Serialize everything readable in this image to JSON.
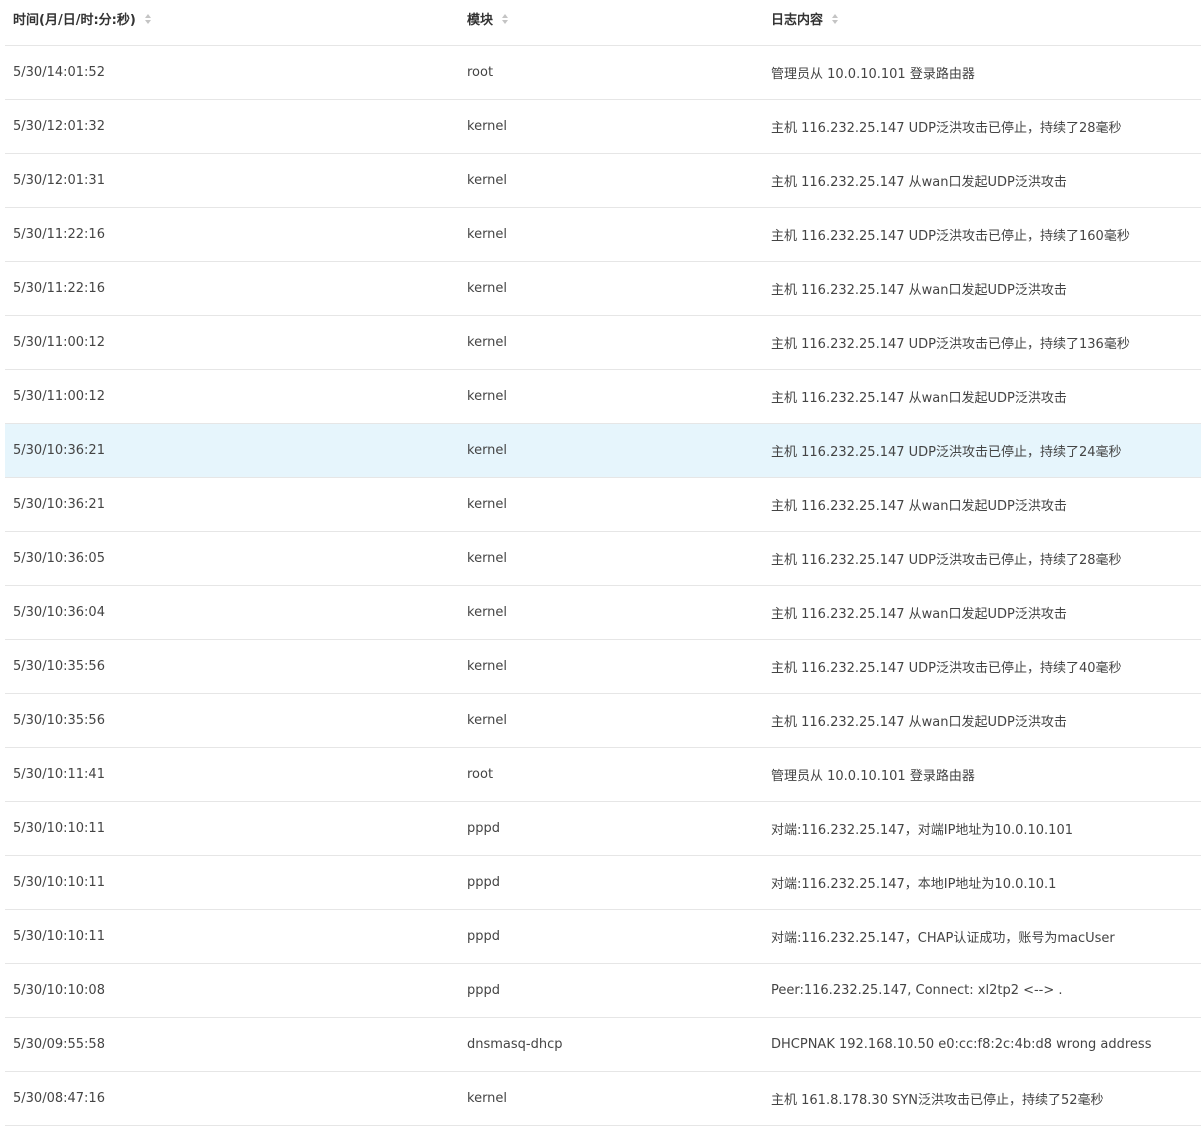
{
  "table": {
    "columns": [
      {
        "label": "时间(月/日/时:分:秒)"
      },
      {
        "label": "模块"
      },
      {
        "label": "日志内容"
      }
    ],
    "highlight_color": "#e6f5fc",
    "rows": [
      {
        "time": "5/30/14:01:52",
        "module": "root",
        "content": "管理员从 10.0.10.101 登录路由器"
      },
      {
        "time": "5/30/12:01:32",
        "module": "kernel",
        "content": "主机 116.232.25.147 UDP泛洪攻击已停止，持续了28毫秒"
      },
      {
        "time": "5/30/12:01:31",
        "module": "kernel",
        "content": "主机 116.232.25.147 从wan口发起UDP泛洪攻击"
      },
      {
        "time": "5/30/11:22:16",
        "module": "kernel",
        "content": "主机 116.232.25.147 UDP泛洪攻击已停止，持续了160毫秒"
      },
      {
        "time": "5/30/11:22:16",
        "module": "kernel",
        "content": "主机 116.232.25.147 从wan口发起UDP泛洪攻击"
      },
      {
        "time": "5/30/11:00:12",
        "module": "kernel",
        "content": "主机 116.232.25.147 UDP泛洪攻击已停止，持续了136毫秒"
      },
      {
        "time": "5/30/11:00:12",
        "module": "kernel",
        "content": "主机 116.232.25.147 从wan口发起UDP泛洪攻击"
      },
      {
        "time": "5/30/10:36:21",
        "module": "kernel",
        "content": "主机 116.232.25.147 UDP泛洪攻击已停止，持续了24毫秒",
        "highlighted": true
      },
      {
        "time": "5/30/10:36:21",
        "module": "kernel",
        "content": "主机 116.232.25.147 从wan口发起UDP泛洪攻击"
      },
      {
        "time": "5/30/10:36:05",
        "module": "kernel",
        "content": "主机 116.232.25.147 UDP泛洪攻击已停止，持续了28毫秒"
      },
      {
        "time": "5/30/10:36:04",
        "module": "kernel",
        "content": "主机 116.232.25.147 从wan口发起UDP泛洪攻击"
      },
      {
        "time": "5/30/10:35:56",
        "module": "kernel",
        "content": "主机 116.232.25.147 UDP泛洪攻击已停止，持续了40毫秒"
      },
      {
        "time": "5/30/10:35:56",
        "module": "kernel",
        "content": "主机 116.232.25.147 从wan口发起UDP泛洪攻击"
      },
      {
        "time": "5/30/10:11:41",
        "module": "root",
        "content": "管理员从 10.0.10.101 登录路由器"
      },
      {
        "time": "5/30/10:10:11",
        "module": "pppd",
        "content": "对端:116.232.25.147，对端IP地址为10.0.10.101"
      },
      {
        "time": "5/30/10:10:11",
        "module": "pppd",
        "content": "对端:116.232.25.147，本地IP地址为10.0.10.1"
      },
      {
        "time": "5/30/10:10:11",
        "module": "pppd",
        "content": "对端:116.232.25.147，CHAP认证成功，账号为macUser"
      },
      {
        "time": "5/30/10:10:08",
        "module": "pppd",
        "content": "Peer:116.232.25.147, Connect: xl2tp2 <--> ."
      },
      {
        "time": "5/30/09:55:58",
        "module": "dnsmasq-dhcp",
        "content": "DHCPNAK 192.168.10.50 e0:cc:f8:2c:4b:d8 wrong address"
      },
      {
        "time": "5/30/08:47:16",
        "module": "kernel",
        "content": "主机 161.8.178.30 SYN泛洪攻击已停止，持续了52毫秒"
      }
    ]
  }
}
